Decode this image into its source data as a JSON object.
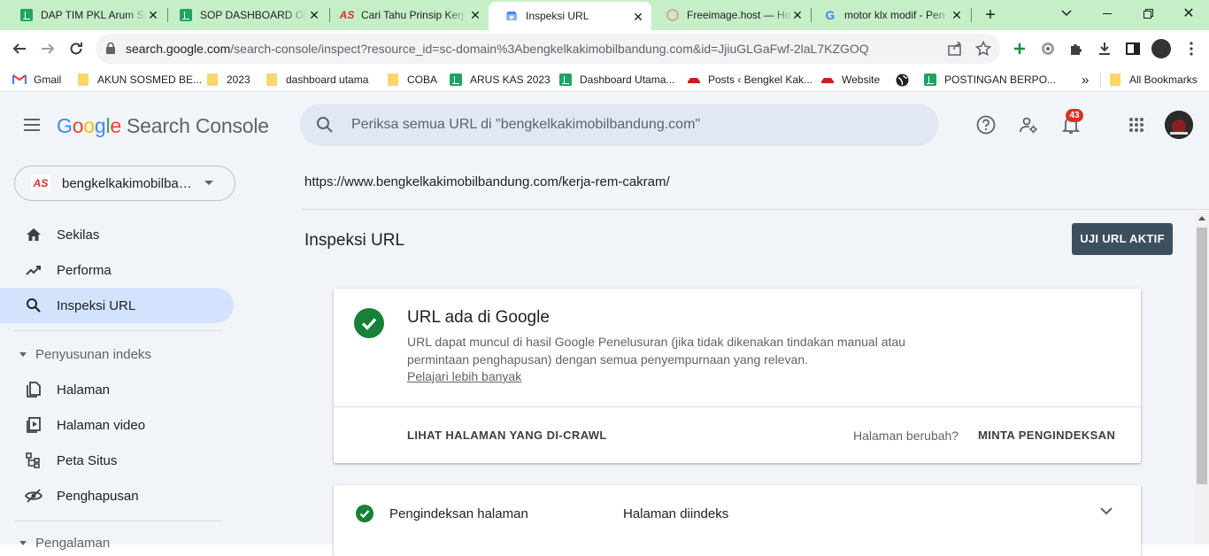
{
  "browser": {
    "tabs": [
      {
        "title": "DAP TIM PKL Arum Sa",
        "icon": "sheets-icon"
      },
      {
        "title": "SOP DASHBOARD OP",
        "icon": "sheets-icon"
      },
      {
        "title": "Cari Tahu Prinsip Kerj",
        "icon": "as-logo-icon"
      },
      {
        "title": "Inspeksi URL",
        "icon": "search-console-icon",
        "active": true
      },
      {
        "title": "Freeimage.host — Ho",
        "icon": "freeimage-icon"
      },
      {
        "title": "motor klx modif - Pen",
        "icon": "google-icon"
      }
    ],
    "address_host": "search.google.com",
    "address_path": "/search-console/inspect?resource_id=sc-domain%3Abengkelkakimobilbandung.com&id=JjiuGLGaFwf-2laL7KZGOQ",
    "bookmarks": [
      {
        "label": "Gmail",
        "icon": "gmail-icon"
      },
      {
        "label": "AKUN SOSMED BE...",
        "icon": "folder-icon"
      },
      {
        "label": "2023",
        "icon": "folder-icon"
      },
      {
        "label": "dashboard utama",
        "icon": "folder-icon"
      },
      {
        "label": "COBA",
        "icon": "folder-icon"
      },
      {
        "label": "ARUS KAS 2023",
        "icon": "sheets-icon"
      },
      {
        "label": "Dashboard Utama...",
        "icon": "sheets-icon"
      },
      {
        "label": "Posts ‹ Bengkel Kak...",
        "icon": "car-icon"
      },
      {
        "label": "Website",
        "icon": "car-icon"
      },
      {
        "label": "",
        "icon": "globe-icon"
      },
      {
        "label": "POSTINGAN BERPO...",
        "icon": "sheets-icon"
      }
    ],
    "overflow": "»",
    "all_bookmarks": "All Bookmarks"
  },
  "app": {
    "logo_google": "Google",
    "logo_product": "Search Console",
    "search_placeholder": "Periksa semua URL di \"bengkelkakimobilbandung.com\"",
    "notification_count": "43",
    "property_badge": "AS",
    "property": "bengkelkakimobilbandung.com"
  },
  "sidebar": {
    "items": [
      {
        "label": "Sekilas",
        "icon": "home-icon"
      },
      {
        "label": "Performa",
        "icon": "trending-up-icon"
      },
      {
        "label": "Inspeksi URL",
        "icon": "search-icon",
        "selected": true
      }
    ],
    "section1": "Penyusunan indeks",
    "section1_items": [
      {
        "label": "Halaman",
        "icon": "pages-icon"
      },
      {
        "label": "Halaman video",
        "icon": "video-pages-icon"
      },
      {
        "label": "Peta Situs",
        "icon": "sitemap-icon"
      },
      {
        "label": "Penghapusan",
        "icon": "removal-icon"
      }
    ],
    "section2": "Pengalaman"
  },
  "main": {
    "inspected_url": "https://www.bengkelkakimobilbandung.com/kerja-rem-cakram/",
    "page_title": "Inspeksi URL",
    "live_test_button": "UJI URL AKTIF",
    "status_title": "URL ada di Google",
    "status_desc": "URL dapat muncul di hasil Google Penelusuran (jika tidak dikenakan tindakan manual atau permintaan penghapusan) dengan semua penyempurnaan yang relevan.",
    "learn_more": "Pelajari lebih banyak",
    "view_crawled": "LIHAT HALAMAN YANG DI-CRAWL",
    "page_changed": "Halaman berubah?",
    "request_indexing": "MINTA PENGINDEKSAN",
    "indexing_label": "Pengindeksan halaman",
    "indexing_value": "Halaman diindeks"
  },
  "colors": {
    "tabstrip": "#c6efc8",
    "app_bg": "#f1f4f9",
    "success": "#188038",
    "live_button": "#3c4f5e",
    "selected_nav": "#d3e3fd"
  }
}
